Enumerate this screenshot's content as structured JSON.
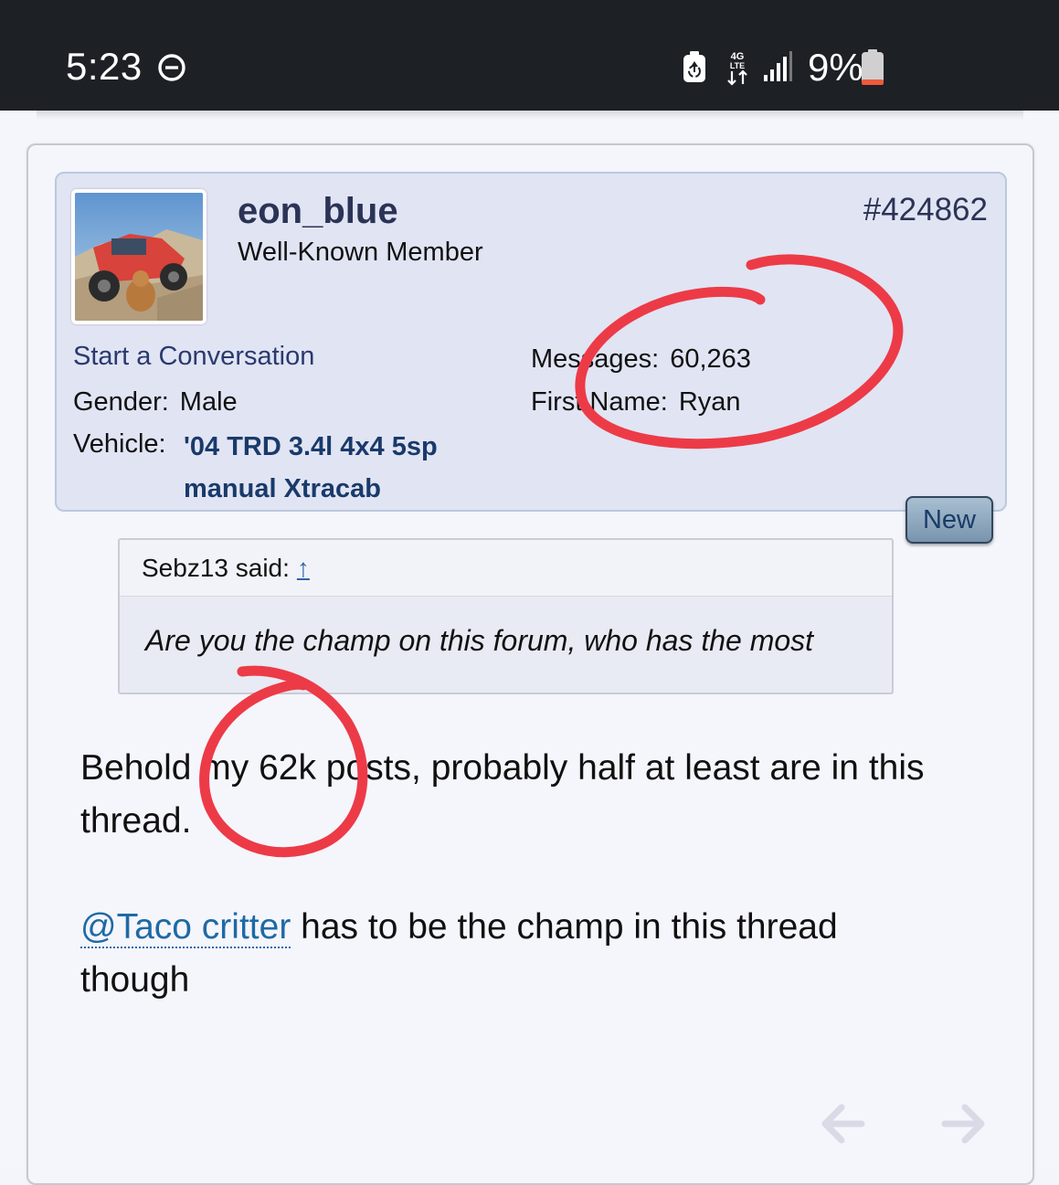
{
  "status_bar": {
    "time": "5:23",
    "battery_percent": "9%",
    "icons": [
      "do-not-disturb-icon",
      "battery-saver-icon",
      "4g-lte-icon",
      "signal-icon",
      "battery-icon"
    ],
    "network_label": "4G LTE"
  },
  "post": {
    "username": "eon_blue",
    "user_title": "Well-Known Member",
    "post_number": "#424862",
    "start_conversation": "Start a Conversation",
    "gender_label": "Gender:",
    "gender_value": "Male",
    "vehicle_label": "Vehicle:",
    "vehicle_value": "'04 TRD 3.4l 4x4 5sp manual Xtracab",
    "messages_label": "Messages:",
    "messages_value": "60,263",
    "first_name_label": "First Name:",
    "first_name_value": "Ryan",
    "new_badge": "New",
    "quote": {
      "author": "Sebz13 said:",
      "jump_arrow": "↑",
      "text": "Are you the champ on this forum, who has the most"
    },
    "message": {
      "line1": "Behold my 62k posts, probably half at least are in this thread.",
      "mention": "@Taco critter",
      "line2_rest": " has to be the champ in this thread though"
    }
  },
  "colors": {
    "status_bar_bg": "#1d2024",
    "user_box_bg": "#e1e4f3",
    "username": "#2b3356",
    "link": "#1d6aa5",
    "annotation_red": "#ec3b47"
  }
}
